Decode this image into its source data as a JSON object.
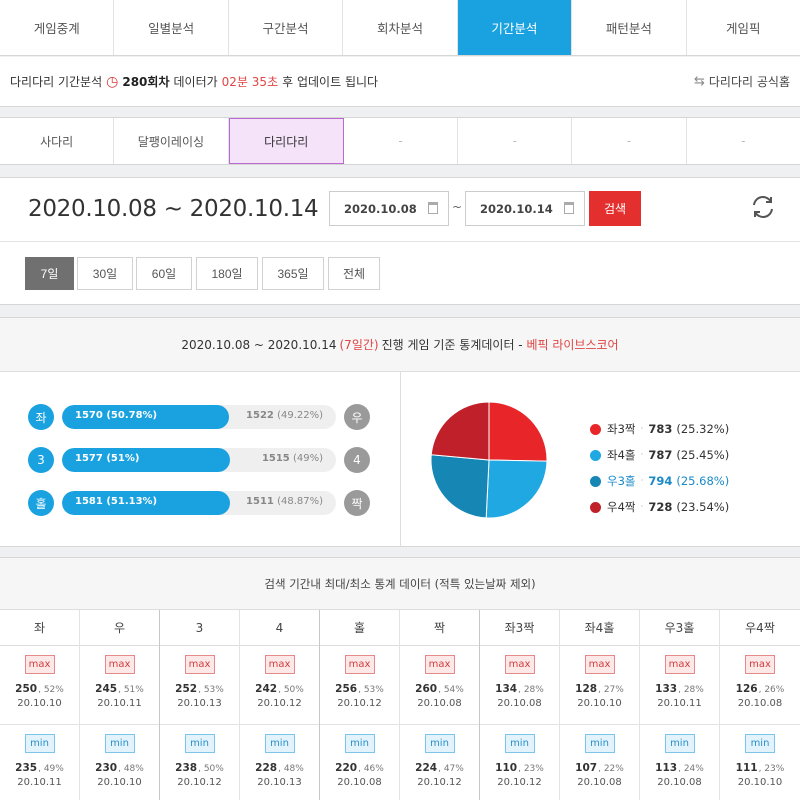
{
  "main_tabs": [
    "게임중계",
    "일별분석",
    "구간분석",
    "회차분석",
    "기간분석",
    "패턴분석",
    "게임픽"
  ],
  "main_tab_active": 4,
  "info_bar": {
    "prefix": "다리다리 기간분석",
    "round": "280회차",
    "text1": "데이터가",
    "time": "02분 35초",
    "text2": "후 업데이트 됩니다",
    "official_link": "다리다리 공식홈"
  },
  "sub_tabs": [
    "사다리",
    "달팽이레이싱",
    "다리다리",
    "-",
    "-",
    "-",
    "-"
  ],
  "sub_tab_active": 2,
  "date_panel": {
    "range_text": "2020.10.08 ~ 2020.10.14",
    "start_date": "2020.10.08",
    "end_date": "2020.10.14",
    "tilde": "~",
    "search_label": "검색",
    "periods": [
      "7일",
      "30일",
      "60일",
      "180일",
      "365일",
      "전체"
    ],
    "period_active": 0
  },
  "stats": {
    "range": "2020.10.08 ~ 2020.10.14",
    "days": "(7일간)",
    "desc": "진행 게임 기준 통계데이터 -",
    "source": "베픽 라이브스코어",
    "bars": [
      {
        "left_label": "좌",
        "right_label": "우",
        "left_count": "1570",
        "left_pct": "(50.78%)",
        "right_count": "1522",
        "right_pct": "(49.22%)",
        "fraction": 0.5078
      },
      {
        "left_label": "3",
        "right_label": "4",
        "left_count": "1577",
        "left_pct": "(51%)",
        "right_count": "1515",
        "right_pct": "(49%)",
        "fraction": 0.51
      },
      {
        "left_label": "홀",
        "right_label": "짝",
        "left_count": "1581",
        "left_pct": "(51.13%)",
        "right_count": "1511",
        "right_pct": "(48.87%)",
        "fraction": 0.5113
      }
    ]
  },
  "chart_data": {
    "type": "pie",
    "categories": [
      "좌3짝",
      "좌4홀",
      "우3홀",
      "우4짝"
    ],
    "values": [
      783,
      787,
      794,
      728
    ],
    "percents": [
      "(25.32%)",
      "(25.45%)",
      "(25.68%)",
      "(23.54%)"
    ],
    "colors": [
      "#e8262a",
      "#1fa8e2",
      "#1686b5",
      "#c0202a"
    ]
  },
  "extremes": {
    "title": "검색 기간내 최대/최소 통계 데이터 (적특 있는날짜 제외)",
    "max_label": "max",
    "min_label": "min",
    "columns": [
      {
        "label": "좌",
        "max": {
          "value": "250",
          "pct": ", 52%",
          "date": "20.10.10"
        },
        "min": {
          "value": "235",
          "pct": ", 49%",
          "date": "20.10.11"
        }
      },
      {
        "label": "우",
        "max": {
          "value": "245",
          "pct": ", 51%",
          "date": "20.10.11"
        },
        "min": {
          "value": "230",
          "pct": ", 48%",
          "date": "20.10.10"
        }
      },
      {
        "label": "3",
        "max": {
          "value": "252",
          "pct": ", 53%",
          "date": "20.10.13"
        },
        "min": {
          "value": "238",
          "pct": ", 50%",
          "date": "20.10.12"
        }
      },
      {
        "label": "4",
        "max": {
          "value": "242",
          "pct": ", 50%",
          "date": "20.10.12"
        },
        "min": {
          "value": "228",
          "pct": ", 48%",
          "date": "20.10.13"
        }
      },
      {
        "label": "홀",
        "max": {
          "value": "256",
          "pct": ", 53%",
          "date": "20.10.12"
        },
        "min": {
          "value": "220",
          "pct": ", 46%",
          "date": "20.10.08"
        }
      },
      {
        "label": "짝",
        "max": {
          "value": "260",
          "pct": ", 54%",
          "date": "20.10.08"
        },
        "min": {
          "value": "224",
          "pct": ", 47%",
          "date": "20.10.12"
        }
      },
      {
        "label": "좌3짝",
        "max": {
          "value": "134",
          "pct": ", 28%",
          "date": "20.10.08"
        },
        "min": {
          "value": "110",
          "pct": ", 23%",
          "date": "20.10.12"
        }
      },
      {
        "label": "좌4홀",
        "max": {
          "value": "128",
          "pct": ", 27%",
          "date": "20.10.10"
        },
        "min": {
          "value": "107",
          "pct": ", 22%",
          "date": "20.10.08"
        }
      },
      {
        "label": "우3홀",
        "max": {
          "value": "133",
          "pct": ", 28%",
          "date": "20.10.11"
        },
        "min": {
          "value": "113",
          "pct": ", 24%",
          "date": "20.10.08"
        }
      },
      {
        "label": "우4짝",
        "max": {
          "value": "126",
          "pct": ", 26%",
          "date": "20.10.08"
        },
        "min": {
          "value": "111",
          "pct": ", 23%",
          "date": "20.10.10"
        }
      }
    ]
  }
}
